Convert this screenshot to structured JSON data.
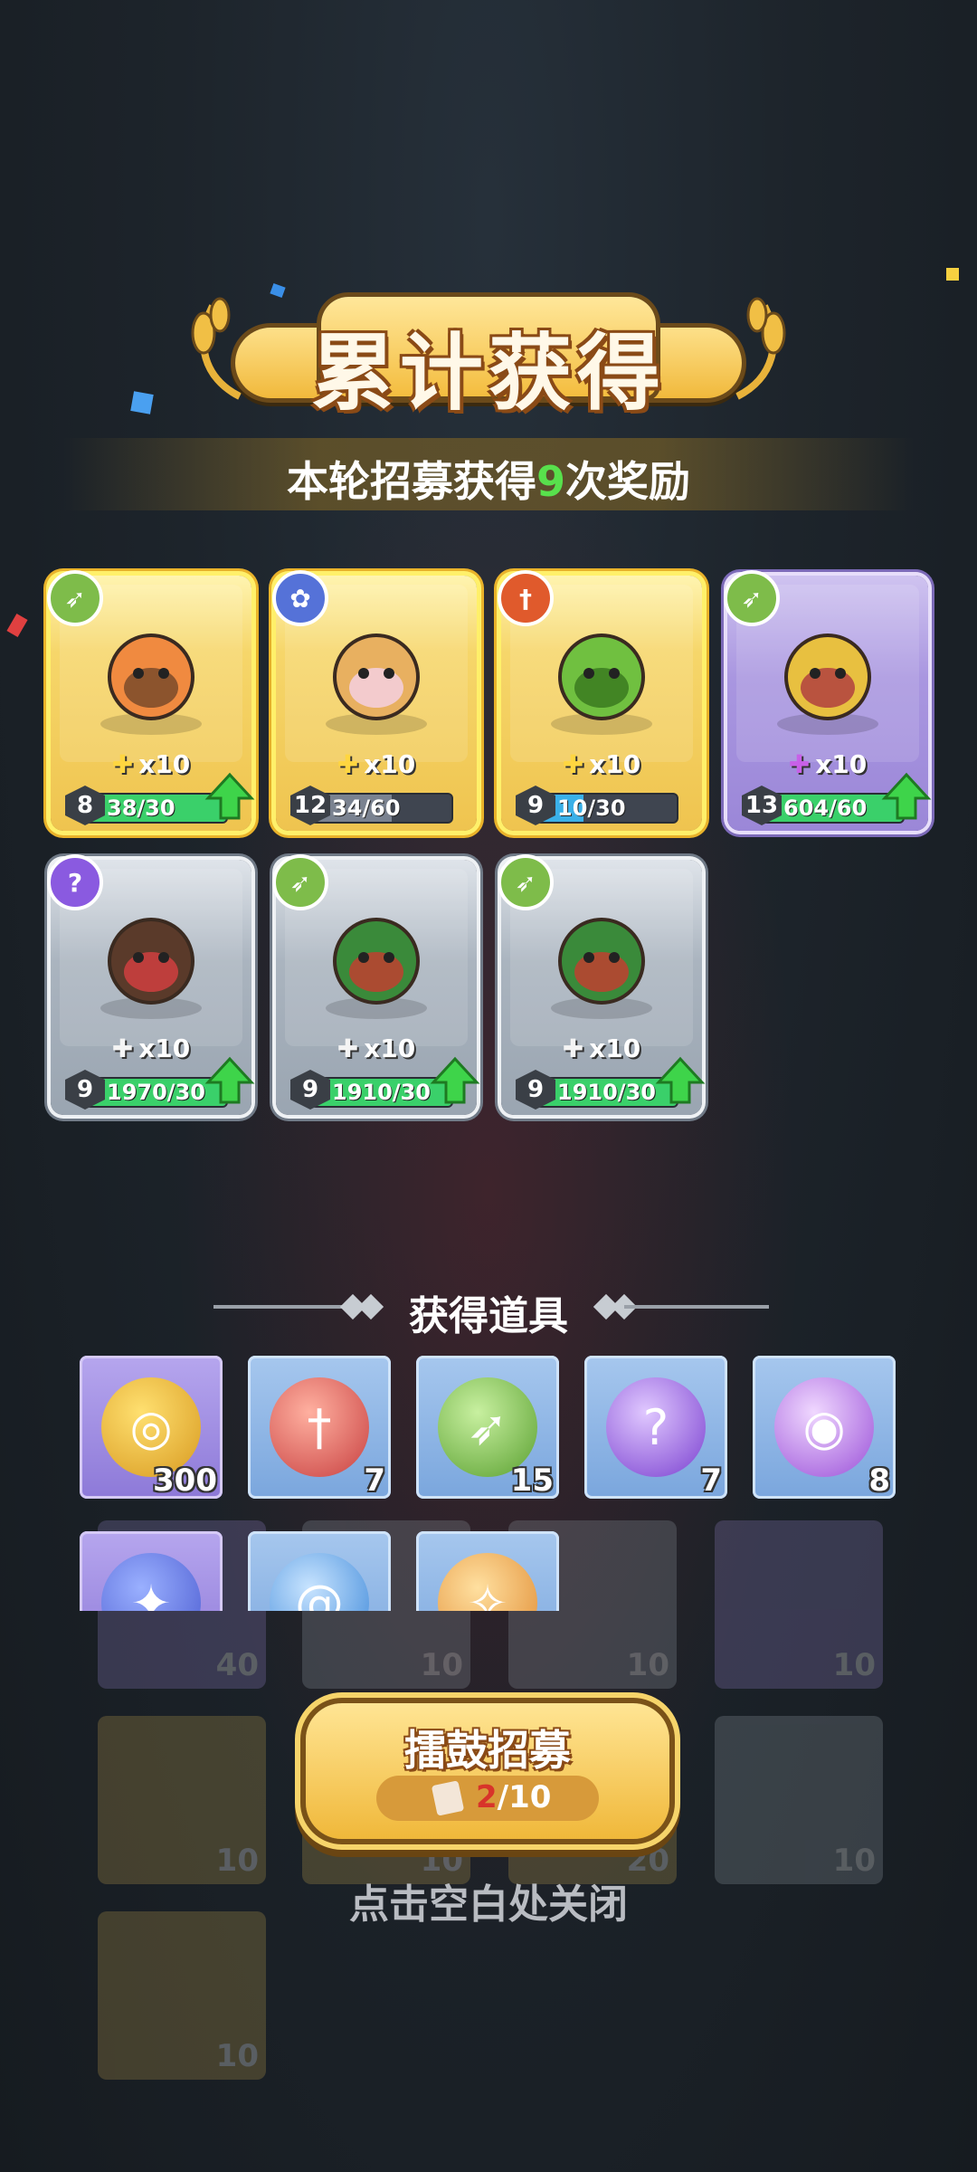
{
  "title": "累计获得",
  "subtitle": {
    "prefix": "本轮招募获得",
    "count": "9",
    "suffix": "次奖励"
  },
  "heroes": [
    {
      "rarity": "gold",
      "class_icon": "bow-icon",
      "class_color": "green",
      "level": "8",
      "count": "x10",
      "progress": "38/30",
      "fill_pct": 100,
      "fill_color": "green",
      "upgradable": true
    },
    {
      "rarity": "gold",
      "class_icon": "paw-icon",
      "class_color": "blue",
      "level": "12",
      "count": "x10",
      "progress": "34/60",
      "fill_pct": 57,
      "fill_color": "grey",
      "upgradable": false
    },
    {
      "rarity": "gold",
      "class_icon": "sword-icon",
      "class_color": "red",
      "level": "9",
      "count": "x10",
      "progress": "10/30",
      "fill_pct": 33,
      "fill_color": "blue",
      "upgradable": false
    },
    {
      "rarity": "purple",
      "class_icon": "bow-icon",
      "class_color": "green",
      "level": "13",
      "count": "x10",
      "progress": "604/60",
      "fill_pct": 100,
      "fill_color": "green",
      "upgradable": true
    },
    {
      "rarity": "grey",
      "class_icon": "staff-icon",
      "class_color": "violet",
      "level": "9",
      "count": "x10",
      "progress": "1970/30",
      "fill_pct": 100,
      "fill_color": "green",
      "upgradable": true
    },
    {
      "rarity": "grey",
      "class_icon": "bow-icon",
      "class_color": "green",
      "level": "9",
      "count": "x10",
      "progress": "1910/30",
      "fill_pct": 100,
      "fill_color": "green",
      "upgradable": true
    },
    {
      "rarity": "grey",
      "class_icon": "bow-icon",
      "class_color": "green",
      "level": "9",
      "count": "x10",
      "progress": "1910/30",
      "fill_pct": 100,
      "fill_color": "green",
      "upgradable": true
    }
  ],
  "items_section_title": "获得道具",
  "items": [
    {
      "name": "gold-coin",
      "icon": "coin-icon",
      "qty": "300",
      "tile": "purple"
    },
    {
      "name": "sword-token",
      "icon": "sword-icon",
      "qty": "7",
      "tile": "blue"
    },
    {
      "name": "bow-token",
      "icon": "bow-icon",
      "qty": "15",
      "tile": "blue"
    },
    {
      "name": "staff-token",
      "icon": "staff-icon",
      "qty": "7",
      "tile": "blue"
    },
    {
      "name": "eye-token",
      "icon": "eye-icon",
      "qty": "8",
      "tile": "blue"
    }
  ],
  "items_row2": [
    {
      "icon": "paw-icon"
    },
    {
      "icon": "swirl-icon"
    },
    {
      "icon": "wings-icon"
    }
  ],
  "background_counts": [
    "40",
    "10",
    "10",
    "10",
    "10",
    "10",
    "20",
    "10",
    "10"
  ],
  "recruit": {
    "label": "擂鼓招募",
    "current": "2",
    "total": "/10"
  },
  "close_hint": "点击空白处关闭"
}
